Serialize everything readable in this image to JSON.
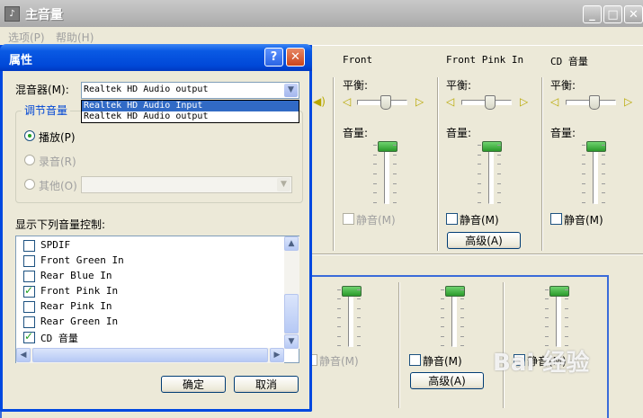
{
  "main_window": {
    "title": "主音量",
    "menu": [
      "选项(P)",
      "帮助(H)"
    ],
    "caption_buttons": {
      "minimize": "_",
      "maximize": "□",
      "close": "✕"
    }
  },
  "channels": [
    {
      "name": "Front",
      "balance_label": "平衡:",
      "volume_label": "音量:",
      "mute_label": "静音(M)",
      "mute_enabled": false,
      "advanced_label": ""
    },
    {
      "name": "Front Pink In",
      "balance_label": "平衡:",
      "volume_label": "音量:",
      "mute_label": "静音(M)",
      "mute_enabled": true,
      "advanced_label": "高级(A)"
    },
    {
      "name": "CD 音量",
      "balance_label": "平衡:",
      "volume_label": "音量:",
      "mute_label": "静音(M)",
      "mute_enabled": true,
      "advanced_label": ""
    }
  ],
  "second_window": {
    "mute_labels": [
      "静音(M)",
      "静音(M)",
      "静音(M)"
    ],
    "advanced_label": "高级(A)"
  },
  "dialog": {
    "title": "属性",
    "help": "?",
    "close": "✕",
    "mixer_label": "混音器(M):",
    "mixer_value": "Realtek HD Audio output",
    "mixer_options": [
      "Realtek HD Audio Input",
      "Realtek HD Audio output"
    ],
    "mixer_highlighted_index": 0,
    "group_title": "调节音量",
    "radios": [
      {
        "label": "播放(P)",
        "checked": true,
        "enabled": true
      },
      {
        "label": "录音(R)",
        "checked": false,
        "enabled": false
      },
      {
        "label": "其他(O)",
        "checked": false,
        "enabled": false
      }
    ],
    "controls_label": "显示下列音量控制:",
    "controls": [
      {
        "label": "SPDIF",
        "checked": false
      },
      {
        "label": "Front Green In",
        "checked": false
      },
      {
        "label": "Rear Blue In",
        "checked": false
      },
      {
        "label": "Front Pink In",
        "checked": true
      },
      {
        "label": "Rear Pink In",
        "checked": false
      },
      {
        "label": "Rear Green In",
        "checked": false
      },
      {
        "label": "CD 音量",
        "checked": true
      }
    ],
    "ok_label": "确定",
    "cancel_label": "取消"
  },
  "icons": {
    "speaker": "speaker-icon",
    "arrow_up": "▲",
    "arrow_down": "▼",
    "arrow_left": "◀",
    "arrow_right": "▶",
    "dropdown": "▼"
  },
  "watermark": "Bai 经验"
}
